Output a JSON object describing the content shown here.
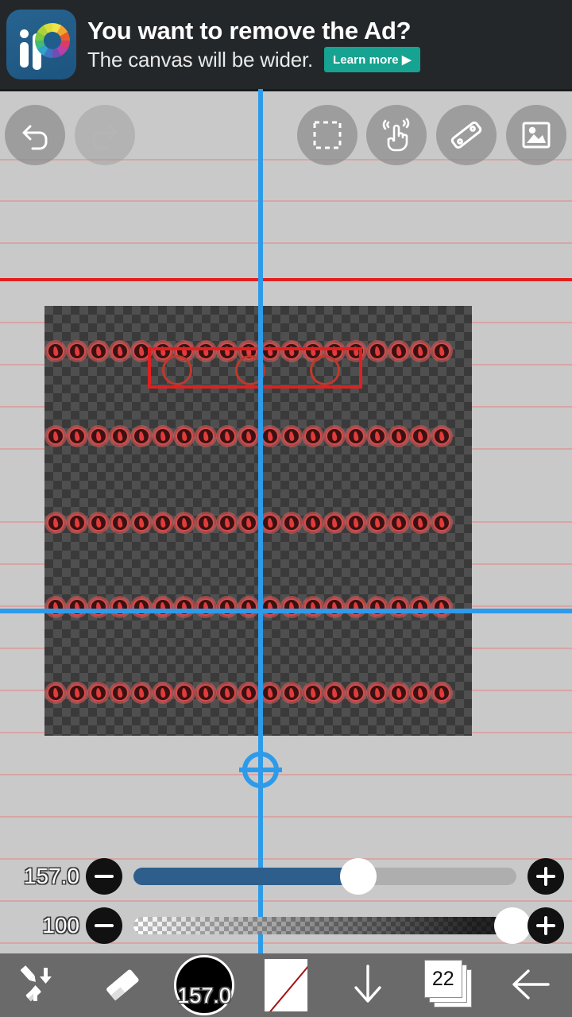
{
  "ad": {
    "headline": "You want to remove the Ad?",
    "subline": "The canvas will be wider.",
    "cta_label": "Learn more ▶",
    "logo_name": "ibispaint-logo",
    "background_color": "#23272a",
    "cta_color": "#16a391"
  },
  "top_toolbar": {
    "buttons": [
      {
        "name": "undo-button",
        "icon": "undo-arrow-icon",
        "enabled": true
      },
      {
        "name": "redo-button",
        "icon": "redo-arrow-icon",
        "enabled": false
      },
      {
        "name": "select-button",
        "icon": "dashed-selection-icon",
        "enabled": true
      },
      {
        "name": "finger-button",
        "icon": "tapping-finger-icon",
        "enabled": true
      },
      {
        "name": "ruler-button",
        "icon": "ruler-icon",
        "enabled": true
      },
      {
        "name": "image-button",
        "icon": "photo-image-icon",
        "enabled": true
      }
    ]
  },
  "canvas": {
    "background": "transparency-checkerboard",
    "stamp_rows": 5,
    "stamps_per_row": 19,
    "stamp_icon": "red-flame-circle-stamp",
    "overlay": {
      "name": "red-rectangle-overlay",
      "circle_count": 3,
      "color": "#e02020"
    },
    "symmetry": {
      "vertical_line_color": "#2d9bea",
      "horizontal_line_color": "#2d9bea",
      "pivot_icon": "symmetry-pivot-crosshair-icon"
    },
    "guide_line_color": "#d9a3a3"
  },
  "sliders": {
    "brush_size": {
      "name": "brush-size-slider",
      "value": "157.0",
      "fill_percent": 55,
      "fill_color": "#2e5f8c",
      "decrease_icon": "minus-icon",
      "increase_icon": "plus-icon"
    },
    "opacity": {
      "name": "opacity-slider",
      "value": "100",
      "fill_percent": 100,
      "decrease_icon": "minus-icon",
      "increase_icon": "plus-icon"
    }
  },
  "bottom_toolbar": {
    "background_color": "#6a6a6a",
    "items": [
      {
        "name": "brush-eraser-swap-button",
        "icon": "brush-eraser-swap-icon"
      },
      {
        "name": "eraser-button",
        "icon": "eraser-icon"
      },
      {
        "name": "brush-size-button",
        "icon": "brush-size-circle-icon",
        "value": "157.0"
      },
      {
        "name": "color-swatch-button",
        "icon": "transparent-color-swatch-icon"
      },
      {
        "name": "download-button",
        "icon": "down-arrow-icon"
      },
      {
        "name": "layers-button",
        "icon": "layers-stack-icon",
        "value": "22"
      },
      {
        "name": "back-button",
        "icon": "left-arrow-icon"
      }
    ]
  }
}
